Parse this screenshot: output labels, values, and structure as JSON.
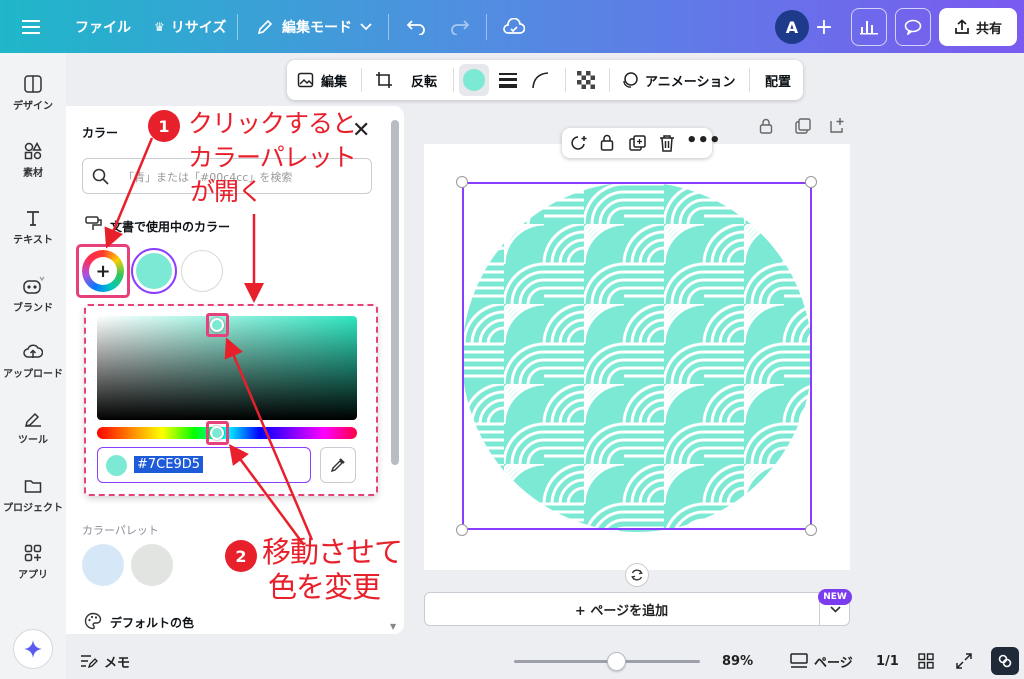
{
  "topbar": {
    "file": "ファイル",
    "resize": "リサイズ",
    "edit_mode": "編集モード",
    "avatar": "A",
    "share": "共有"
  },
  "rail": {
    "items": [
      "デザイン",
      "素材",
      "テキスト",
      "ブランド",
      "アップロード",
      "ツール",
      "プロジェクト",
      "アプリ"
    ]
  },
  "context_toolbar": {
    "edit": "編集",
    "flip": "反転",
    "animation": "アニメーション",
    "position": "配置"
  },
  "panel": {
    "title": "カラー",
    "search_placeholder": "「青」または「#00c4cc」を検索",
    "doc_colors_label": "文書で使用中のカラー",
    "palette_label": "カラーパレット",
    "default_colors_label": "デフォルトの色",
    "hex_value": "#7CE9D5",
    "accent": "#7CE9D5",
    "swatches": [
      "#7CE9D5",
      "#FFFFFF"
    ],
    "palette_swatches": [
      "#D6E8F8",
      "#E2E4E1"
    ]
  },
  "canvas": {
    "add_page": "+ ページを追加",
    "new_badge": "NEW",
    "pattern_color": "#7CE9D5"
  },
  "bottom": {
    "memo": "メモ",
    "zoom": "89%",
    "page": "ページ",
    "page_count": "1/1"
  },
  "annotations": {
    "step1_num": "1",
    "step1_line1": "クリックすると",
    "step1_line2": "カラーパレット",
    "step1_line3": "が開く",
    "step2_num": "2",
    "step2_line1": "移動させて",
    "step2_line2": "色を変更"
  }
}
